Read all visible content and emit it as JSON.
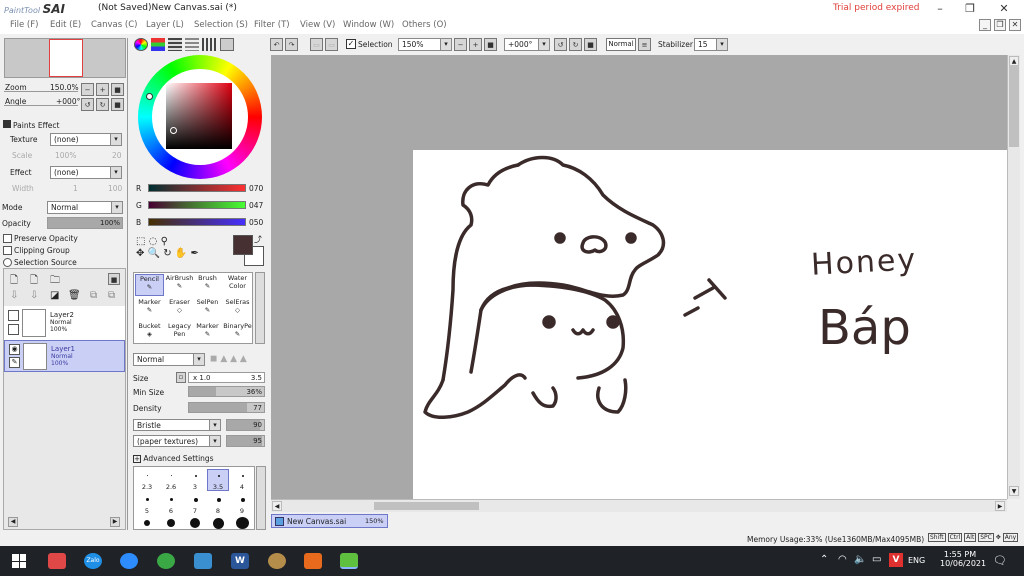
{
  "title": {
    "app_logo_small": "PaintTool",
    "app_logo_big": "SAI",
    "window_title": "(Not Saved)New Canvas.sai (*)",
    "trial": "Trial period expired"
  },
  "menus": [
    "File (F)",
    "Edit (E)",
    "Canvas (C)",
    "Layer (L)",
    "Selection (S)",
    "Filter (T)",
    "View (V)",
    "Window (W)",
    "Others (O)"
  ],
  "navigator": {
    "zoom_label": "Zoom",
    "zoom_value": "150.0%",
    "angle_label": "Angle",
    "angle_value": "+000°"
  },
  "paints_effect": {
    "header": "Paints Effect",
    "texture_label": "Texture",
    "texture_value": "(none)",
    "scale_label": "Scale",
    "scale_value": "100%",
    "scale_num": "20",
    "effect_label": "Effect",
    "effect_value": "(none)",
    "width_label": "Width",
    "width_value": "1",
    "width_num": "100"
  },
  "layer_props": {
    "mode_label": "Mode",
    "mode_value": "Normal",
    "opacity_label": "Opacity",
    "opacity_value": "100%",
    "preserve_opacity": "Preserve Opacity",
    "clipping_group": "Clipping Group",
    "selection_source": "Selection Source"
  },
  "layers": [
    {
      "name": "Layer2",
      "mode": "Normal",
      "opacity": "100%"
    },
    {
      "name": "Layer1",
      "mode": "Normal",
      "opacity": "100%"
    }
  ],
  "color": {
    "r_label": "R",
    "r_value": "070",
    "g_label": "G",
    "g_value": "047",
    "b_label": "B",
    "b_value": "050",
    "current": "#463032"
  },
  "tools": [
    {
      "name": "Pencil"
    },
    {
      "name": "AirBrush"
    },
    {
      "name": "Brush"
    },
    {
      "name": "Water Color"
    },
    {
      "name": "Marker"
    },
    {
      "name": "Eraser"
    },
    {
      "name": "SelPen"
    },
    {
      "name": "SelEras"
    },
    {
      "name": "Bucket"
    },
    {
      "name": "Legacy Pen"
    },
    {
      "name": "Marker"
    },
    {
      "name": "BinaryPe"
    }
  ],
  "brush": {
    "mode": "Normal",
    "size_label": "Size",
    "size_mult": "x 1.0",
    "size_value": "3.5",
    "min_size_label": "Min Size",
    "min_size_value": "36%",
    "density_label": "Density",
    "density_value": "77",
    "shape": "Bristle",
    "shape_value": "90",
    "texture": "(paper textures)",
    "texture_value": "95",
    "advanced": "Advanced Settings",
    "sizes": [
      "2.3",
      "2.6",
      "3",
      "3.5",
      "4",
      "5",
      "6",
      "7",
      "8",
      "9"
    ]
  },
  "toolbar": {
    "selection_label": "Selection",
    "zoom": "150%",
    "angle": "+000°",
    "blend": "Normal",
    "stabilizer_label": "Stabilizer",
    "stabilizer_value": "15"
  },
  "canvas": {
    "text_line1": "Honey",
    "text_line2": "Báp",
    "stroke": "#3a2a2a"
  },
  "doc_tab": {
    "name": "New Canvas.sai",
    "zoom": "150%"
  },
  "status": {
    "memory": "Memory Usage:33% (Use1360MB/Max4095MB)",
    "keys": [
      "Shift",
      "Ctrl",
      "Alt",
      "SPC"
    ],
    "any": "Any"
  },
  "taskbar": {
    "lang": "ENG",
    "time": "1:55 PM",
    "date": "10/06/2021"
  }
}
